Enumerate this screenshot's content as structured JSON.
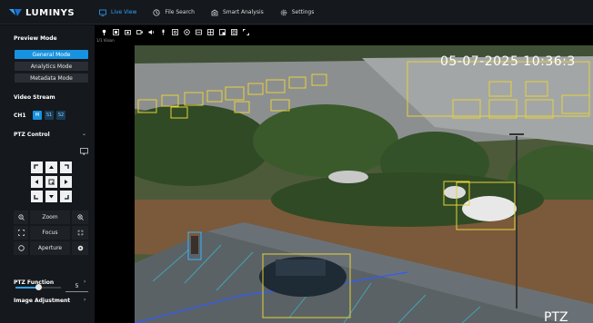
{
  "app": {
    "brand": "LUMINYS",
    "accent": "#1692e0"
  },
  "nav": [
    {
      "label": "Live View",
      "icon": "monitor-icon",
      "active": true
    },
    {
      "label": "File Search",
      "icon": "history-icon",
      "active": false
    },
    {
      "label": "Smart Analysis",
      "icon": "analysis-icon",
      "active": false
    },
    {
      "label": "Settings",
      "icon": "gear-icon",
      "active": false
    }
  ],
  "sidebar": {
    "preview_mode": {
      "title": "Preview Mode",
      "modes": [
        "General Mode",
        "Analytics Mode",
        "Metadata Mode"
      ],
      "active": "General Mode"
    },
    "video_stream": {
      "title": "Video Stream",
      "channel": "CH1",
      "streams": [
        "M",
        "S1",
        "S2"
      ],
      "active": "M"
    },
    "ptz": {
      "title": "PTZ Control",
      "zoom_label": "Zoom",
      "focus_label": "Focus",
      "aperture_label": "Aperture",
      "speed_value": "5",
      "speed_fraction": 0.5
    },
    "sections": [
      "PTZ Function",
      "Image Adjustment"
    ]
  },
  "video": {
    "toolbar_icons": [
      "pin-icon",
      "snapshot-icon",
      "camera-icon",
      "record-icon",
      "audio-icon",
      "mic-icon",
      "zoom-icon",
      "target-icon",
      "stretch-icon",
      "grid-icon",
      "pip-icon",
      "fullscreen-icon",
      "expand-icon"
    ],
    "resolution_label": "1/1 Vision",
    "osd_timestamp": "05-07-2025 10:36:3",
    "osd_camera": "PTZ "
  }
}
